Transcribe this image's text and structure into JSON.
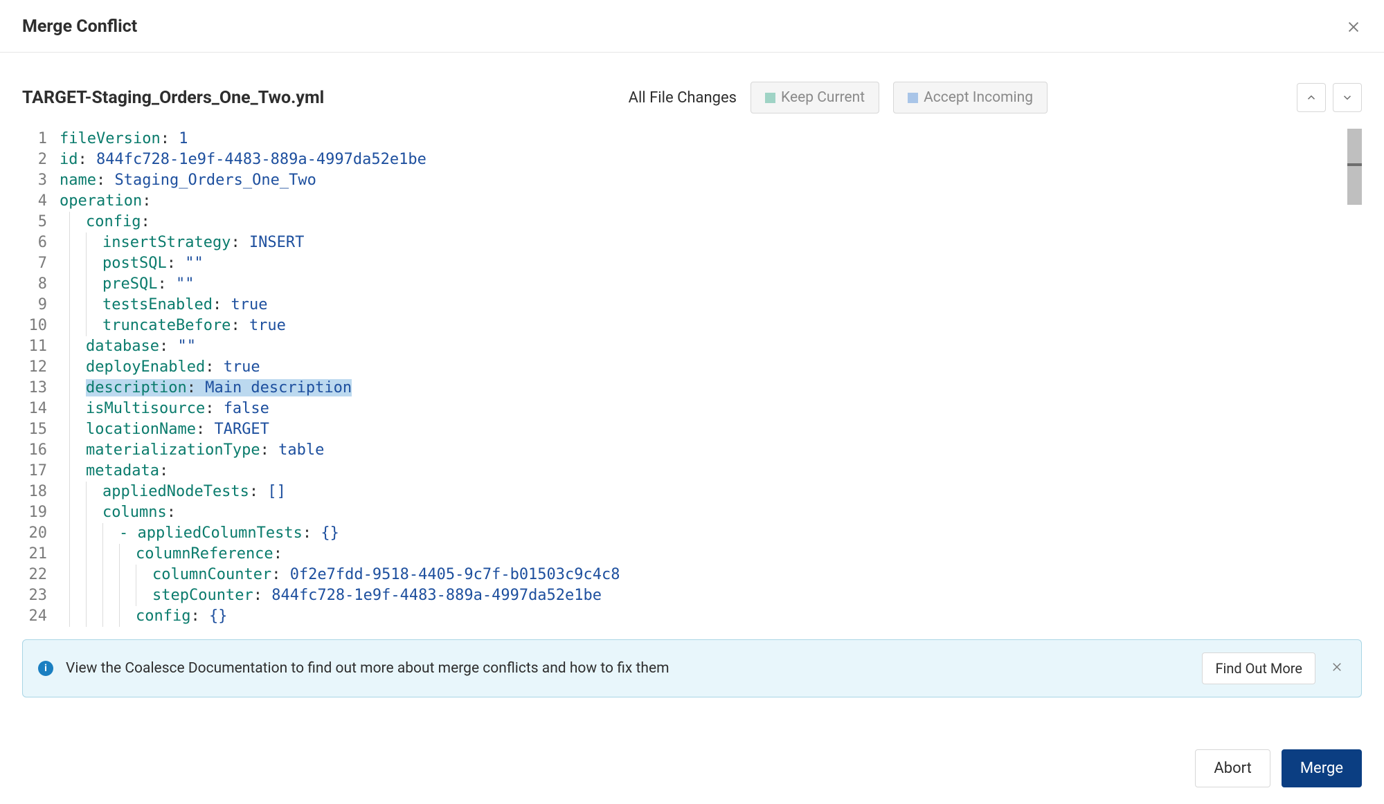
{
  "header": {
    "title": "Merge Conflict"
  },
  "file": {
    "name": "TARGET-Staging_Orders_One_Two.yml"
  },
  "controls": {
    "all_changes": "All File Changes",
    "keep_current": "Keep Current",
    "accept_incoming": "Accept Incoming"
  },
  "code": {
    "lines": [
      {
        "n": 1,
        "indent": 0,
        "key": "fileVersion",
        "val": "1"
      },
      {
        "n": 2,
        "indent": 0,
        "key": "id",
        "val": "844fc728-1e9f-4483-889a-4997da52e1be"
      },
      {
        "n": 3,
        "indent": 0,
        "key": "name",
        "val": "Staging_Orders_One_Two"
      },
      {
        "n": 4,
        "indent": 0,
        "key": "operation",
        "val": ""
      },
      {
        "n": 5,
        "indent": 1,
        "key": "config",
        "val": ""
      },
      {
        "n": 6,
        "indent": 2,
        "key": "insertStrategy",
        "val": "INSERT"
      },
      {
        "n": 7,
        "indent": 2,
        "key": "postSQL",
        "val": "\"\""
      },
      {
        "n": 8,
        "indent": 2,
        "key": "preSQL",
        "val": "\"\""
      },
      {
        "n": 9,
        "indent": 2,
        "key": "testsEnabled",
        "val": "true"
      },
      {
        "n": 10,
        "indent": 2,
        "key": "truncateBefore",
        "val": "true"
      },
      {
        "n": 11,
        "indent": 1,
        "key": "database",
        "val": "\"\""
      },
      {
        "n": 12,
        "indent": 1,
        "key": "deployEnabled",
        "val": "true"
      },
      {
        "n": 13,
        "indent": 1,
        "key": "description",
        "val": "Main description",
        "highlight": true
      },
      {
        "n": 14,
        "indent": 1,
        "key": "isMultisource",
        "val": "false"
      },
      {
        "n": 15,
        "indent": 1,
        "key": "locationName",
        "val": "TARGET"
      },
      {
        "n": 16,
        "indent": 1,
        "key": "materializationType",
        "val": "table"
      },
      {
        "n": 17,
        "indent": 1,
        "key": "metadata",
        "val": ""
      },
      {
        "n": 18,
        "indent": 2,
        "key": "appliedNodeTests",
        "val": "[]"
      },
      {
        "n": 19,
        "indent": 2,
        "key": "columns",
        "val": ""
      },
      {
        "n": 20,
        "indent": 3,
        "prefix": "- ",
        "key": "appliedColumnTests",
        "val": "{}"
      },
      {
        "n": 21,
        "indent": 4,
        "key": "columnReference",
        "val": ""
      },
      {
        "n": 22,
        "indent": 5,
        "key": "columnCounter",
        "val": "0f2e7fdd-9518-4405-9c7f-b01503c9c4c8"
      },
      {
        "n": 23,
        "indent": 5,
        "key": "stepCounter",
        "val": "844fc728-1e9f-4483-889a-4997da52e1be"
      },
      {
        "n": 24,
        "indent": 4,
        "key": "config",
        "val": "{}"
      }
    ]
  },
  "banner": {
    "text": "View the Coalesce Documentation to find out more about merge conflicts and how to fix them",
    "cta": "Find Out More"
  },
  "footer": {
    "abort": "Abort",
    "merge": "Merge"
  }
}
